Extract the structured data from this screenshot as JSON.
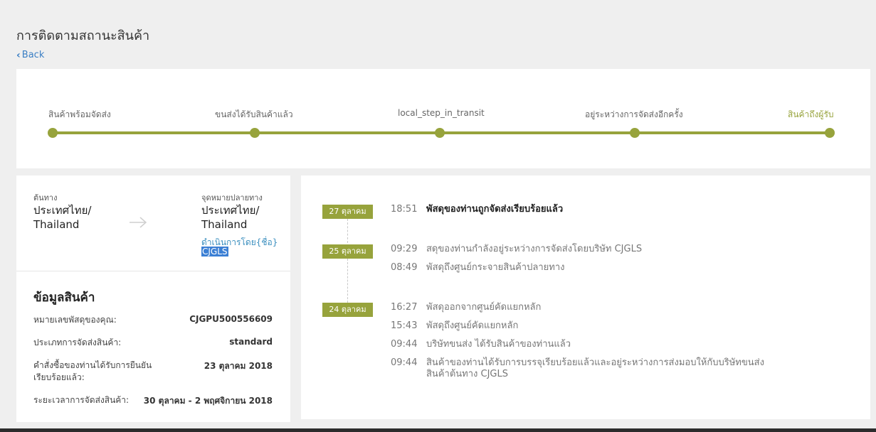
{
  "page": {
    "title": "การติดตามสถานะสินค้า",
    "back_label": "Back"
  },
  "steps": [
    {
      "label": "สินค้าพร้อมจัดส่ง"
    },
    {
      "label": "ขนส่งได้รับสินค้าแล้ว"
    },
    {
      "label": "local_step_in_transit"
    },
    {
      "label": "อยู่ระหว่างการจัดส่งอีกครั้ง"
    },
    {
      "label": "สินค้าถึงผู้รับ"
    }
  ],
  "route": {
    "origin_label": "ต้นทาง",
    "origin_line1": "ประเทศไทย/",
    "origin_line2": "Thailand",
    "destination_label": "จุดหมายปลายทาง",
    "destination_line1": "ประเทศไทย/",
    "destination_line2": "Thailand",
    "operated_by_label": "ดำเนินการโดย{ชื่อ}",
    "carrier": "CJGLS"
  },
  "info": {
    "title": "ข้อมูลสินค้า",
    "rows": [
      {
        "label": "หมายเลขพัสดุของคุณ:",
        "value": "CJGPU500556609"
      },
      {
        "label": "ประเภทการจัดส่งสินค้า:",
        "value": "standard"
      },
      {
        "label": "คำสั่งซื้อของท่านได้รับการยืนยันเรียบร้อยแล้ว:",
        "value": "23 ตุลาคม 2018"
      },
      {
        "label": "ระยะเวลาการจัดส่งสินค้า:",
        "value": "30 ตุลาคม - 2 พฤศจิกายน 2018"
      }
    ]
  },
  "timeline": [
    {
      "date": "27 ตุลาคม",
      "events": [
        {
          "time": "18:51",
          "text": "พัสดุของท่านถูกจัดส่งเรียบร้อยแล้ว"
        }
      ]
    },
    {
      "date": "25 ตุลาคม",
      "events": [
        {
          "time": "09:29",
          "text": "สดุของท่านกำลังอยู่ระหว่างการจัดส่งโดยบริษัท CJGLS"
        },
        {
          "time": "08:49",
          "text": "พัสดุถึงศูนย์กระจายสินค้าปลายทาง"
        }
      ]
    },
    {
      "date": "24 ตุลาคม",
      "events": [
        {
          "time": "16:27",
          "text": "พัสดุออกจากศูนย์คัดแยกหลัก"
        },
        {
          "time": "15:43",
          "text": "พัสดุถึงศูนย์คัดแยกหลัก"
        },
        {
          "time": "09:44",
          "text": "บริษัทขนส่ง ได้รับสินค้าของท่านแล้ว"
        },
        {
          "time": "09:44",
          "text_line1": "สินค้าของท่านได้รับการบรรจุเรียบร้อยแล้วและอยู่ระหว่างการส่งมอบให้กับบริษัทขนส่ง",
          "text_line2": "สินค้าต้นทาง CJGLS"
        }
      ]
    }
  ],
  "colors": {
    "accent": "#97a33c",
    "link": "#3b7fc4"
  }
}
